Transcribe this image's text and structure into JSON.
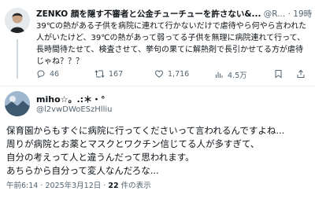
{
  "post1": {
    "display_name": "ZENKO 顔を隠す不審者と公金チューチューを許さない&...",
    "handle": "@R...",
    "separator": "·",
    "time": "19時間",
    "lines": [
      "39℃の熱がある子供を病院に連れて行かないだけで虐待やら何やら言われた",
      "人がいたけど、39℃の熱があって弱ってる子供を無理に病院連れて行って、",
      "長時間待たせて、検査させて、挙句の果てに解熱剤で長引かせてる方が虐待",
      "じゃね？？？"
    ],
    "actions": {
      "replies": "46",
      "reposts": "167",
      "likes": "1,716",
      "views": "4.5万"
    }
  },
  "post2": {
    "display_name": "miho☆。.:＊・°",
    "handle": "@l2vwDWoESzHlliu",
    "lines": [
      "保育園からもすぐに病院に行ってくださいって言われるんですよね...",
      "周りが病院とお薬とマスクとワクチン信じてる人が多すぎて、",
      "自分の考えって人と違うんだって思われます。",
      "あちらから自分って変人なんだろな..."
    ],
    "footer": {
      "time": "午前6:14",
      "dot": "·",
      "date": "2025年3月12日",
      "views_count": "22",
      "views_label": "件の表示"
    }
  },
  "colors": {
    "muted": "#536471",
    "divider": "#eff3f4"
  }
}
